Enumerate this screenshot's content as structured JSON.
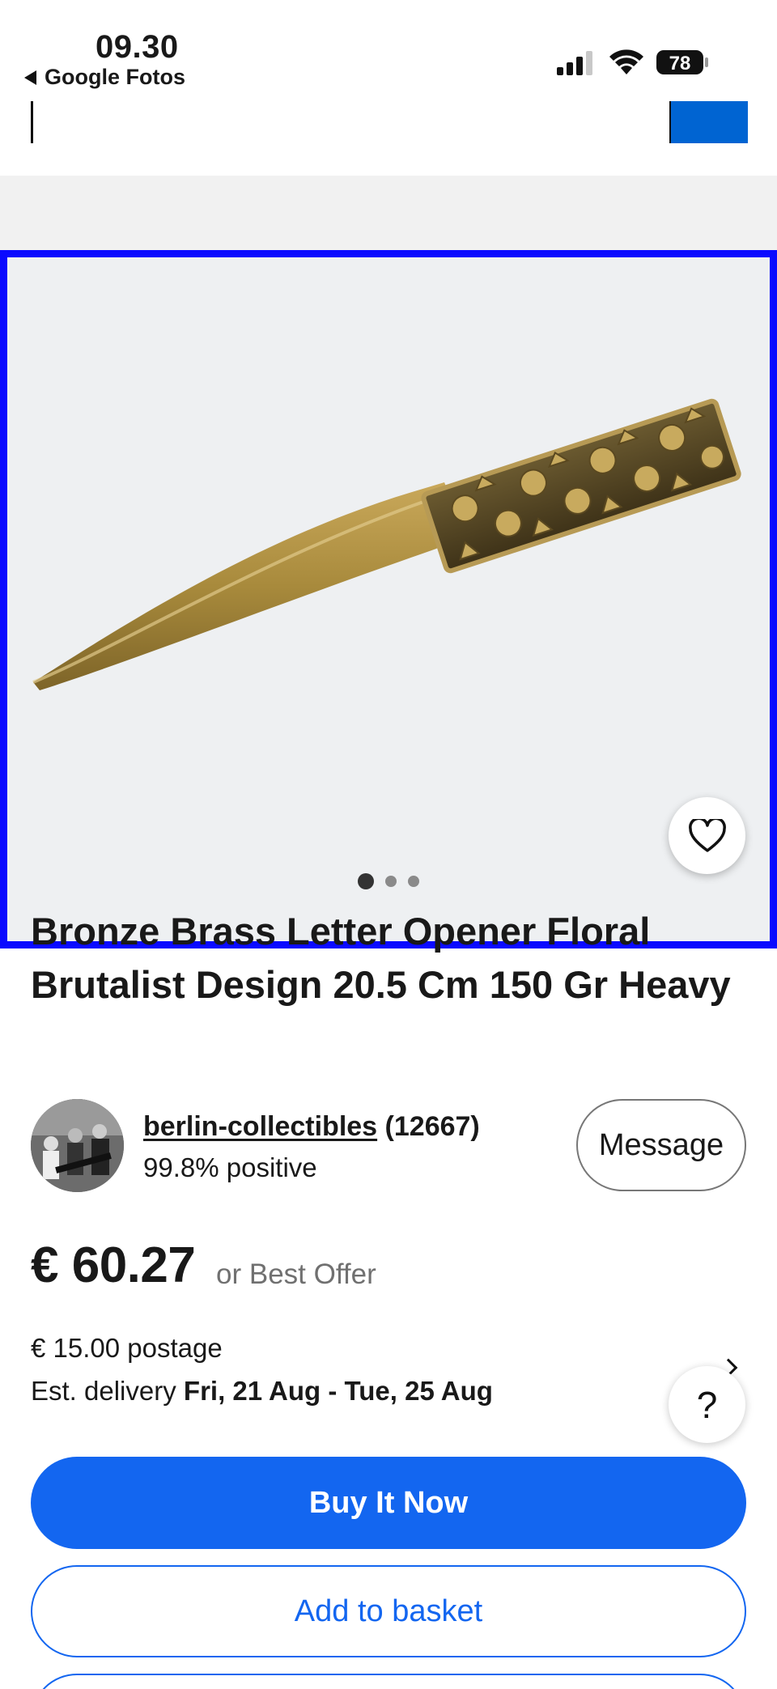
{
  "status_bar": {
    "time": "09.30",
    "back_app": "Google Fotos",
    "battery": "78"
  },
  "gallery": {
    "image_alt": "Bronze brass letter opener with floral handle",
    "current_image": 1,
    "image_count": 3
  },
  "listing": {
    "title": "Bronze Brass Letter Opener Floral Brutalist Design 20.5 Cm 150 Gr Heavy",
    "price": "€ 60.27",
    "best_offer": "or Best Offer",
    "postage": "€ 15.00 postage",
    "delivery_label": "Est. delivery",
    "delivery_dates": "Fri, 21 Aug - Tue, 25 Aug"
  },
  "seller": {
    "name": "berlin-collectibles",
    "count": "(12667)",
    "feedback": "99.8% positive",
    "message_label": "Message"
  },
  "actions": {
    "buy_now": "Buy It Now",
    "add_to_basket": "Add to basket",
    "help": "?"
  },
  "colors": {
    "primary": "#1366f0",
    "selection_border": "#0a0aff",
    "text": "#191919",
    "muted": "#707070"
  }
}
